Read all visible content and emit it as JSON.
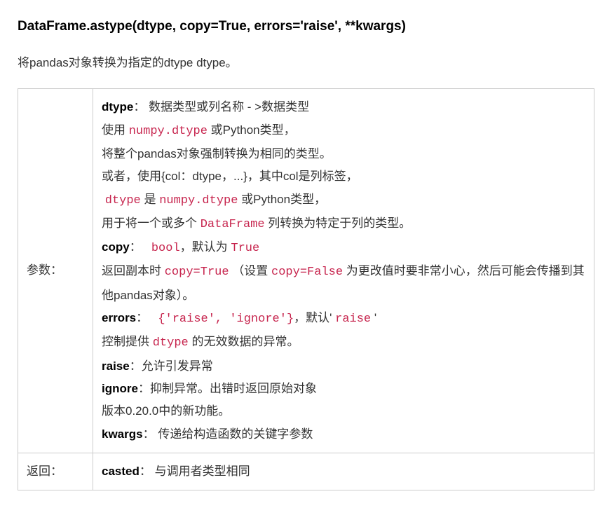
{
  "signature": "DataFrame.astype(dtype, copy=True, errors='raise', **kwargs)",
  "desc": "将pandas对象转换为指定的dtype dtype。",
  "row1_label": "参数：",
  "row2_label": "返回：",
  "dtype": {
    "name": "dtype",
    "sep": "：",
    "t1": " 数据类型或列名称 - >数据类型",
    "l2a": "使用 ",
    "c2": "numpy.dtype",
    "l2b": " 或Python类型，",
    "l3": "将整个pandas对象强制转换为相同的类型。",
    "l4": "或者，使用{col：dtype，...}，其中col是列标签，",
    "c5a": "dtype",
    "l5m": " 是 ",
    "c5b": "numpy.dtype",
    "l5e": " 或Python类型，",
    "l6a": "用于将一个或多个 ",
    "c6": "DataFrame",
    "l6b": " 列转换为特定于列的类型。"
  },
  "copy": {
    "name": "copy",
    "sep": "：",
    "type": "bool",
    "mid": "，默认为 ",
    "def": "True",
    "d1a": "返回副本时 ",
    "d1c": "copy=True",
    "d1b": "（设置 ",
    "d1c2": "copy=False",
    "d1d": " 为更改值时要非常小心，然后可能会传播到其他pandas对象）。"
  },
  "errors": {
    "name": "errors",
    "sep": "：",
    "type": "{'raise', 'ignore'}",
    "mid": "，默认' ",
    "def": "raise",
    "end": " '",
    "d1a": "控制提供 ",
    "d1c": "dtype",
    "d1b": " 的无效数据的异常。"
  },
  "raise": {
    "name": "raise",
    "sep": "：",
    "desc": "允许引发异常"
  },
  "ignore": {
    "name": "ignore",
    "sep": "：",
    "desc": "抑制异常。出错时返回原始对象"
  },
  "newver": "版本0.20.0中的新功能。",
  "kwargs": {
    "name": "kwargs",
    "sep": "：",
    "desc": " 传递给构造函数的关键字参数"
  },
  "ret": {
    "name": "casted",
    "sep": "：",
    "desc": " 与调用者类型相同"
  }
}
